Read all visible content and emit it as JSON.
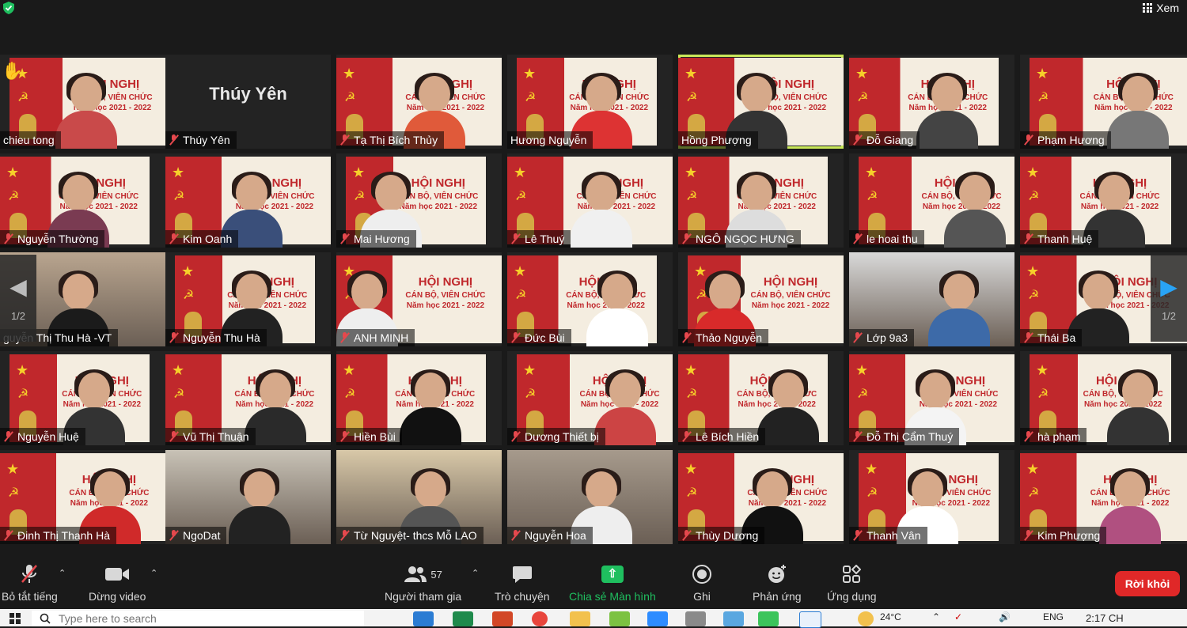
{
  "topbar": {
    "view_label": "Xem",
    "view_icon": "grid-icon",
    "security_icon": "shield-check-icon",
    "security_color": "#1fbf5f"
  },
  "gallery": {
    "page_left": "1/2",
    "page_right": "1/2",
    "active_speaker_color": "#c9e85a",
    "participants": [
      {
        "name": "chieu tong"
      },
      {
        "name": "Thúy Yên"
      },
      {
        "name": "Tạ Thị Bích Thủy"
      },
      {
        "name": "Hương Nguyễn"
      },
      {
        "name": "Hồng Phượng"
      },
      {
        "name": "Đỗ Giang"
      },
      {
        "name": "Phạm Hương"
      },
      {
        "name": "Nguyễn Thường"
      },
      {
        "name": "Kim Oanh"
      },
      {
        "name": "Mai Hương"
      },
      {
        "name": "Lê Thuý"
      },
      {
        "name": "NGÔ NGỌC HƯNG"
      },
      {
        "name": "le hoai thu"
      },
      {
        "name": "Thanh Huệ"
      },
      {
        "name": "guyễn Thị Thu Hà -VT"
      },
      {
        "name": "Nguyễn Thu Hà"
      },
      {
        "name": "ANH MINH"
      },
      {
        "name": "Đức Bùi"
      },
      {
        "name": "Thảo Nguyễn"
      },
      {
        "name": "Lớp 9a3"
      },
      {
        "name": "Thái Ba"
      },
      {
        "name": "Nguyễn Huệ"
      },
      {
        "name": "Vũ Thị Thuận"
      },
      {
        "name": "Hiền Bùi"
      },
      {
        "name": "Dương Thiết bị"
      },
      {
        "name": "Lê Bích Hiền"
      },
      {
        "name": "Đỗ Thị Cẩm Thuý"
      },
      {
        "name": "hà phạm"
      },
      {
        "name": "Đinh Thị Thanh Hà"
      },
      {
        "name": "NgoDat"
      },
      {
        "name": "Từ Nguyệt- thcs Mỗ LAO"
      },
      {
        "name": "Nguyễn Hoa"
      },
      {
        "name": "Thùy Dương"
      },
      {
        "name": "Thanh Vân"
      },
      {
        "name": "Kim Phượng"
      }
    ],
    "banner_title": "HỘI NGHỊ",
    "banner_sub": "CÁN BỘ, VIÊN CHỨC",
    "banner_year": "Năm học 2021 - 2022"
  },
  "toolbar": {
    "mute": "Bỏ tắt tiếng",
    "video": "Dừng video",
    "participants": "Người tham gia",
    "participant_count": "57",
    "chat": "Trò chuyện",
    "share": "Chia sẻ Màn hình",
    "record": "Ghi",
    "reactions": "Phản ứng",
    "apps": "Ứng dụng",
    "leave": "Rời khỏi",
    "share_color": "#1fbf5f",
    "leave_color": "#e02828"
  },
  "taskbar": {
    "search_placeholder": "Type here to search",
    "weather": "24°C",
    "lang": "ENG",
    "time": "2:17 CH"
  }
}
